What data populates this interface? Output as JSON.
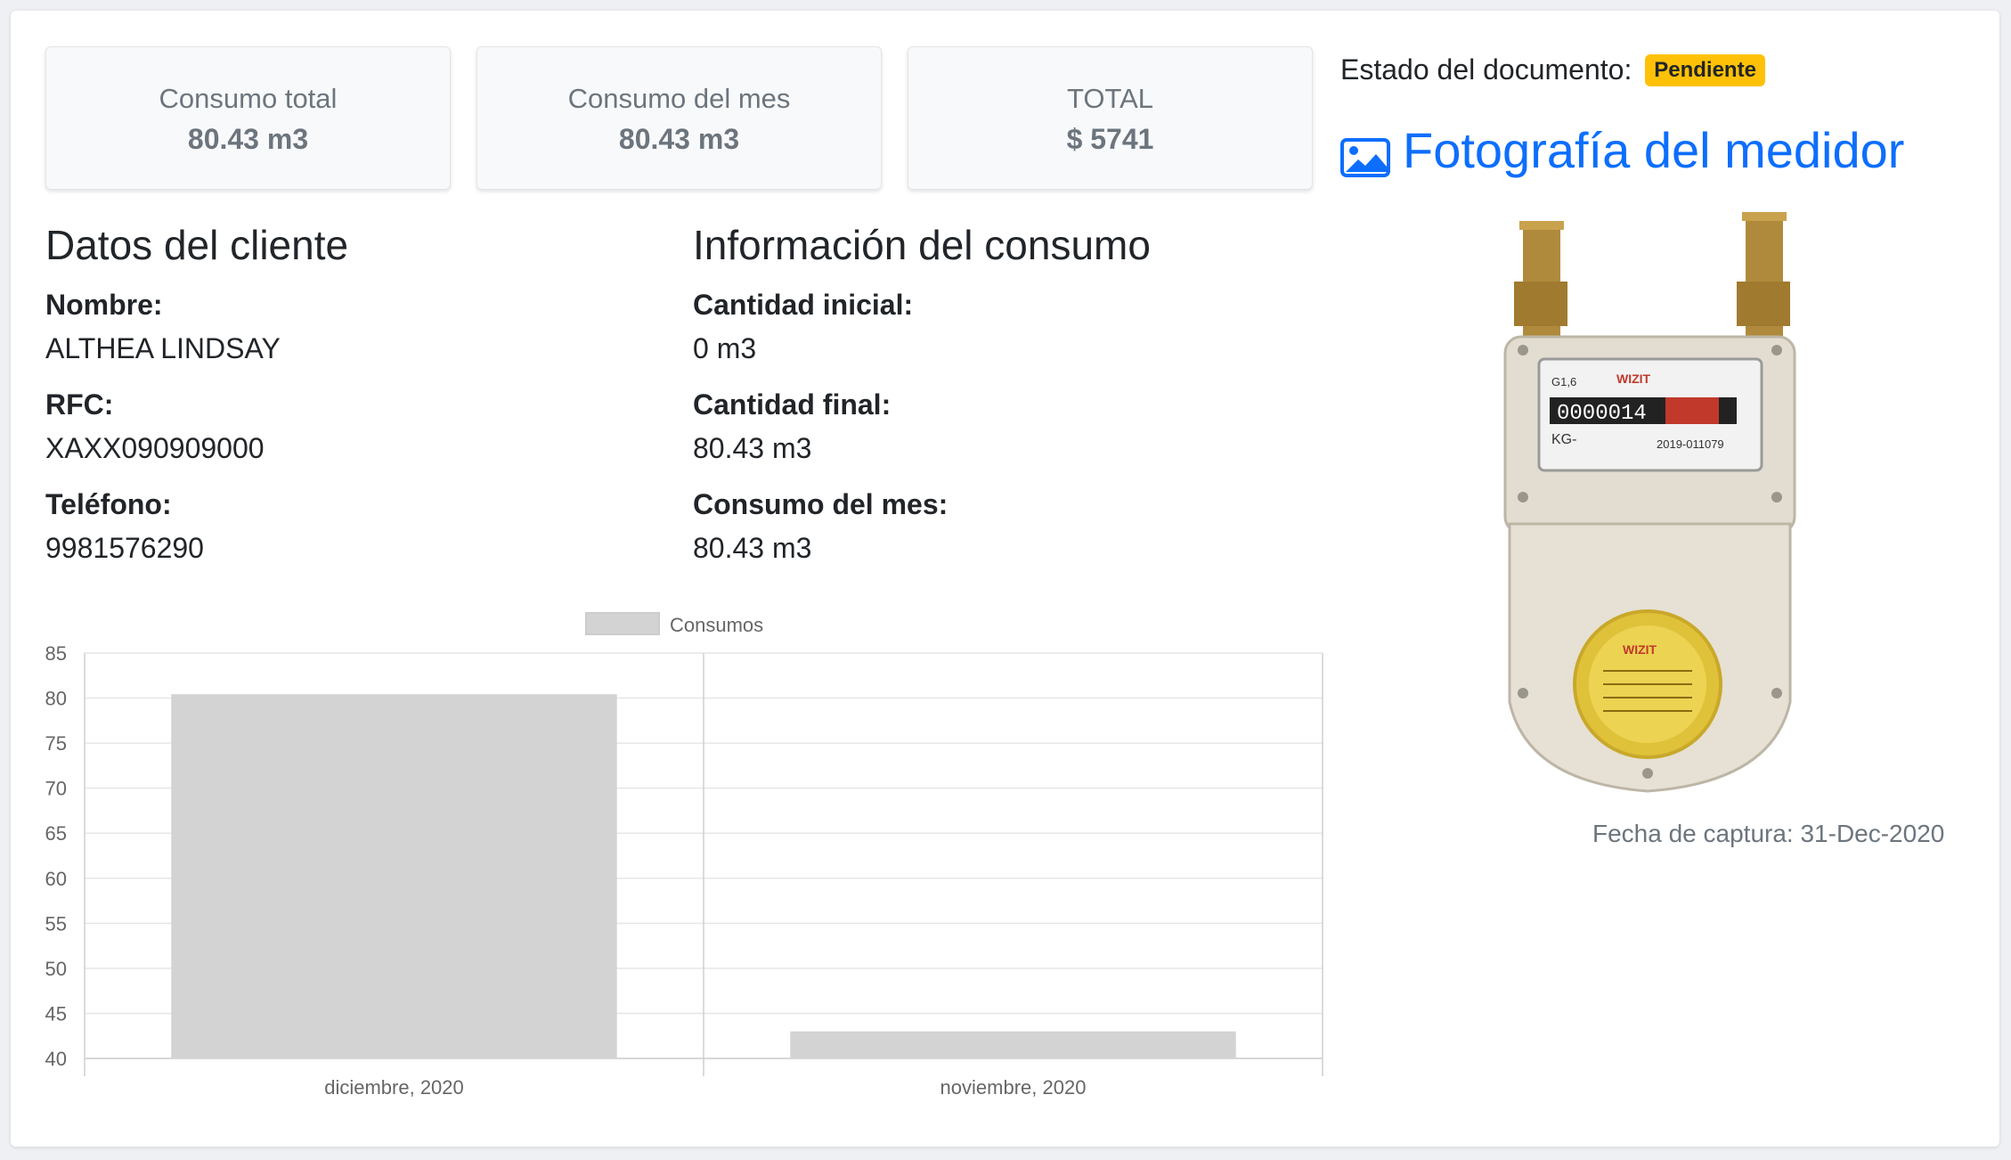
{
  "stats": [
    {
      "label": "Consumo total",
      "value": "80.43 m3"
    },
    {
      "label": "Consumo del mes",
      "value": "80.43 m3"
    },
    {
      "label": "TOTAL",
      "value": "$ 5741"
    }
  ],
  "client": {
    "title": "Datos del cliente",
    "name_label": "Nombre:",
    "name": "ALTHEA LINDSAY",
    "rfc_label": "RFC:",
    "rfc": "XAXX090909000",
    "phone_label": "Teléfono:",
    "phone": "9981576290"
  },
  "consumption": {
    "title": "Información del consumo",
    "initial_label": "Cantidad inicial:",
    "initial": "0 m3",
    "final_label": "Cantidad final:",
    "final": "80.43 m3",
    "month_label": "Consumo del mes:",
    "month": "80.43 m3"
  },
  "document": {
    "status_label": "Estado del documento:",
    "status": "Pendiente",
    "status_color": "#ffc107",
    "photo_link": "Fotografía del medidor",
    "photo_icon": "image-icon",
    "capture_date": "Fecha de captura: 31-Dec-2020"
  },
  "colors": {
    "link": "#0d6efd",
    "bar": "#d3d3d3"
  },
  "chart_data": {
    "type": "bar",
    "categories": [
      "diciembre, 2020",
      "noviembre, 2020"
    ],
    "series": [
      {
        "name": "Consumos",
        "values": [
          80.43,
          43
        ]
      }
    ],
    "ylim": [
      40,
      85
    ],
    "yticks": [
      85,
      80,
      75,
      70,
      65,
      60,
      55,
      50,
      45,
      40
    ],
    "grid": true,
    "legend": "top-center"
  }
}
